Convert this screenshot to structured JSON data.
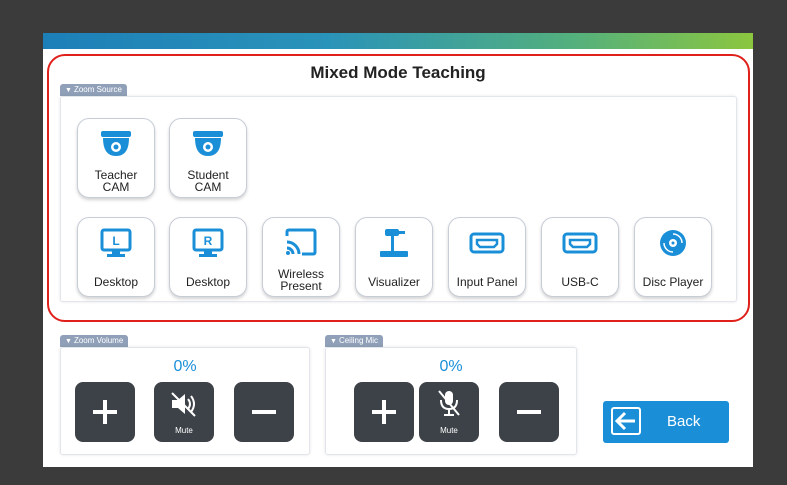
{
  "title": "Mixed Mode Teaching",
  "zoom_source": {
    "group_label": "Zoom Source",
    "row1": [
      {
        "line1": "Teacher",
        "line2": "CAM",
        "icon": "camera-icon"
      },
      {
        "line1": "Student",
        "line2": "CAM",
        "icon": "camera-icon"
      }
    ],
    "row2": [
      {
        "line1": "Desktop",
        "line2": "",
        "icon": "monitor-icon",
        "letter": "L"
      },
      {
        "line1": "Desktop",
        "line2": "",
        "icon": "monitor-icon",
        "letter": "R"
      },
      {
        "line1": "Wireless",
        "line2": "Present",
        "icon": "cast-icon"
      },
      {
        "line1": "Visualizer",
        "line2": "",
        "icon": "document-camera-icon"
      },
      {
        "line1": "Input Panel",
        "line2": "",
        "icon": "hdmi-icon"
      },
      {
        "line1": "USB-C",
        "line2": "",
        "icon": "hdmi-icon"
      },
      {
        "line1": "Disc Player",
        "line2": "",
        "icon": "disc-icon"
      }
    ]
  },
  "zoom_volume": {
    "group_label": "Zoom Volume",
    "level": "0%",
    "mute_label": "Mute"
  },
  "ceiling_mic": {
    "group_label": "Ceiling Mic",
    "level": "0%",
    "mute_label": "Mute"
  },
  "back_label": "Back",
  "colors": {
    "accent_blue": "#1a8fd8",
    "highlight_red": "#e0211b",
    "dark_button": "#3d4248"
  }
}
